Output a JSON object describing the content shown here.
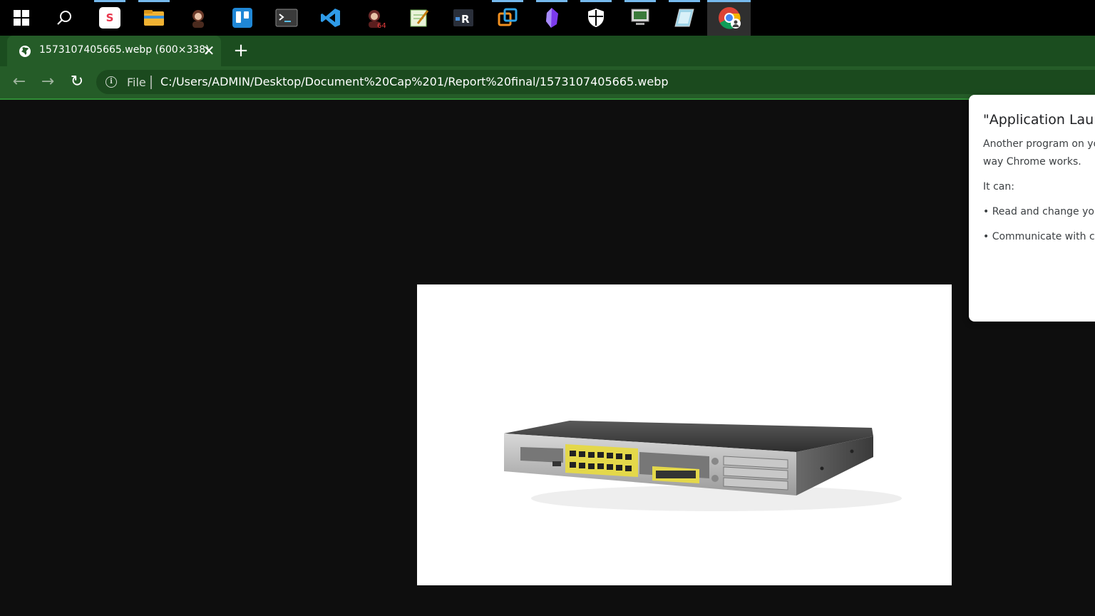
{
  "taskbar": {
    "apps": [
      {
        "icon": "windows-start-icon"
      },
      {
        "icon": "search-icon"
      },
      {
        "icon": "app-s-icon",
        "glyph": "S",
        "color": "#e8334a"
      },
      {
        "icon": "file-explorer-icon"
      },
      {
        "icon": "portrait-app-icon"
      },
      {
        "icon": "trello-icon"
      },
      {
        "icon": "terminal-icon",
        "glyph": ">_"
      },
      {
        "icon": "vscode-icon"
      },
      {
        "icon": "portrait-app-64-icon",
        "glyph": "64"
      },
      {
        "icon": "notepad-app-icon"
      },
      {
        "icon": "r-app-icon",
        "glyph": "R"
      },
      {
        "icon": "vmware-icon"
      },
      {
        "icon": "obsidian-icon"
      },
      {
        "icon": "security-shield-icon"
      },
      {
        "icon": "computer-app-icon"
      },
      {
        "icon": "notebook-app-icon"
      },
      {
        "icon": "chrome-icon"
      }
    ]
  },
  "browser": {
    "tab_title": "1573107405665.webp (600×338)",
    "tab_close": "✕",
    "new_tab": "+",
    "back": "←",
    "forward": "→",
    "reload": "↻",
    "info_glyph": "i",
    "scheme_label": "File",
    "url": "C:/Users/ADMIN/Desktop/Document%20Cap%201/Report%20final/1573107405665.webp"
  },
  "popup": {
    "title": "\"Application Launc",
    "line1": "Another program on yo",
    "line2": "way Chrome works.",
    "line3": "It can:",
    "bullet1": "• Read and change your",
    "bullet2": "• Communicate with coo"
  },
  "colors": {
    "tabstrip": "#1b4d1f",
    "toolbar": "#255c28",
    "page_bg": "#0e0e0e"
  }
}
